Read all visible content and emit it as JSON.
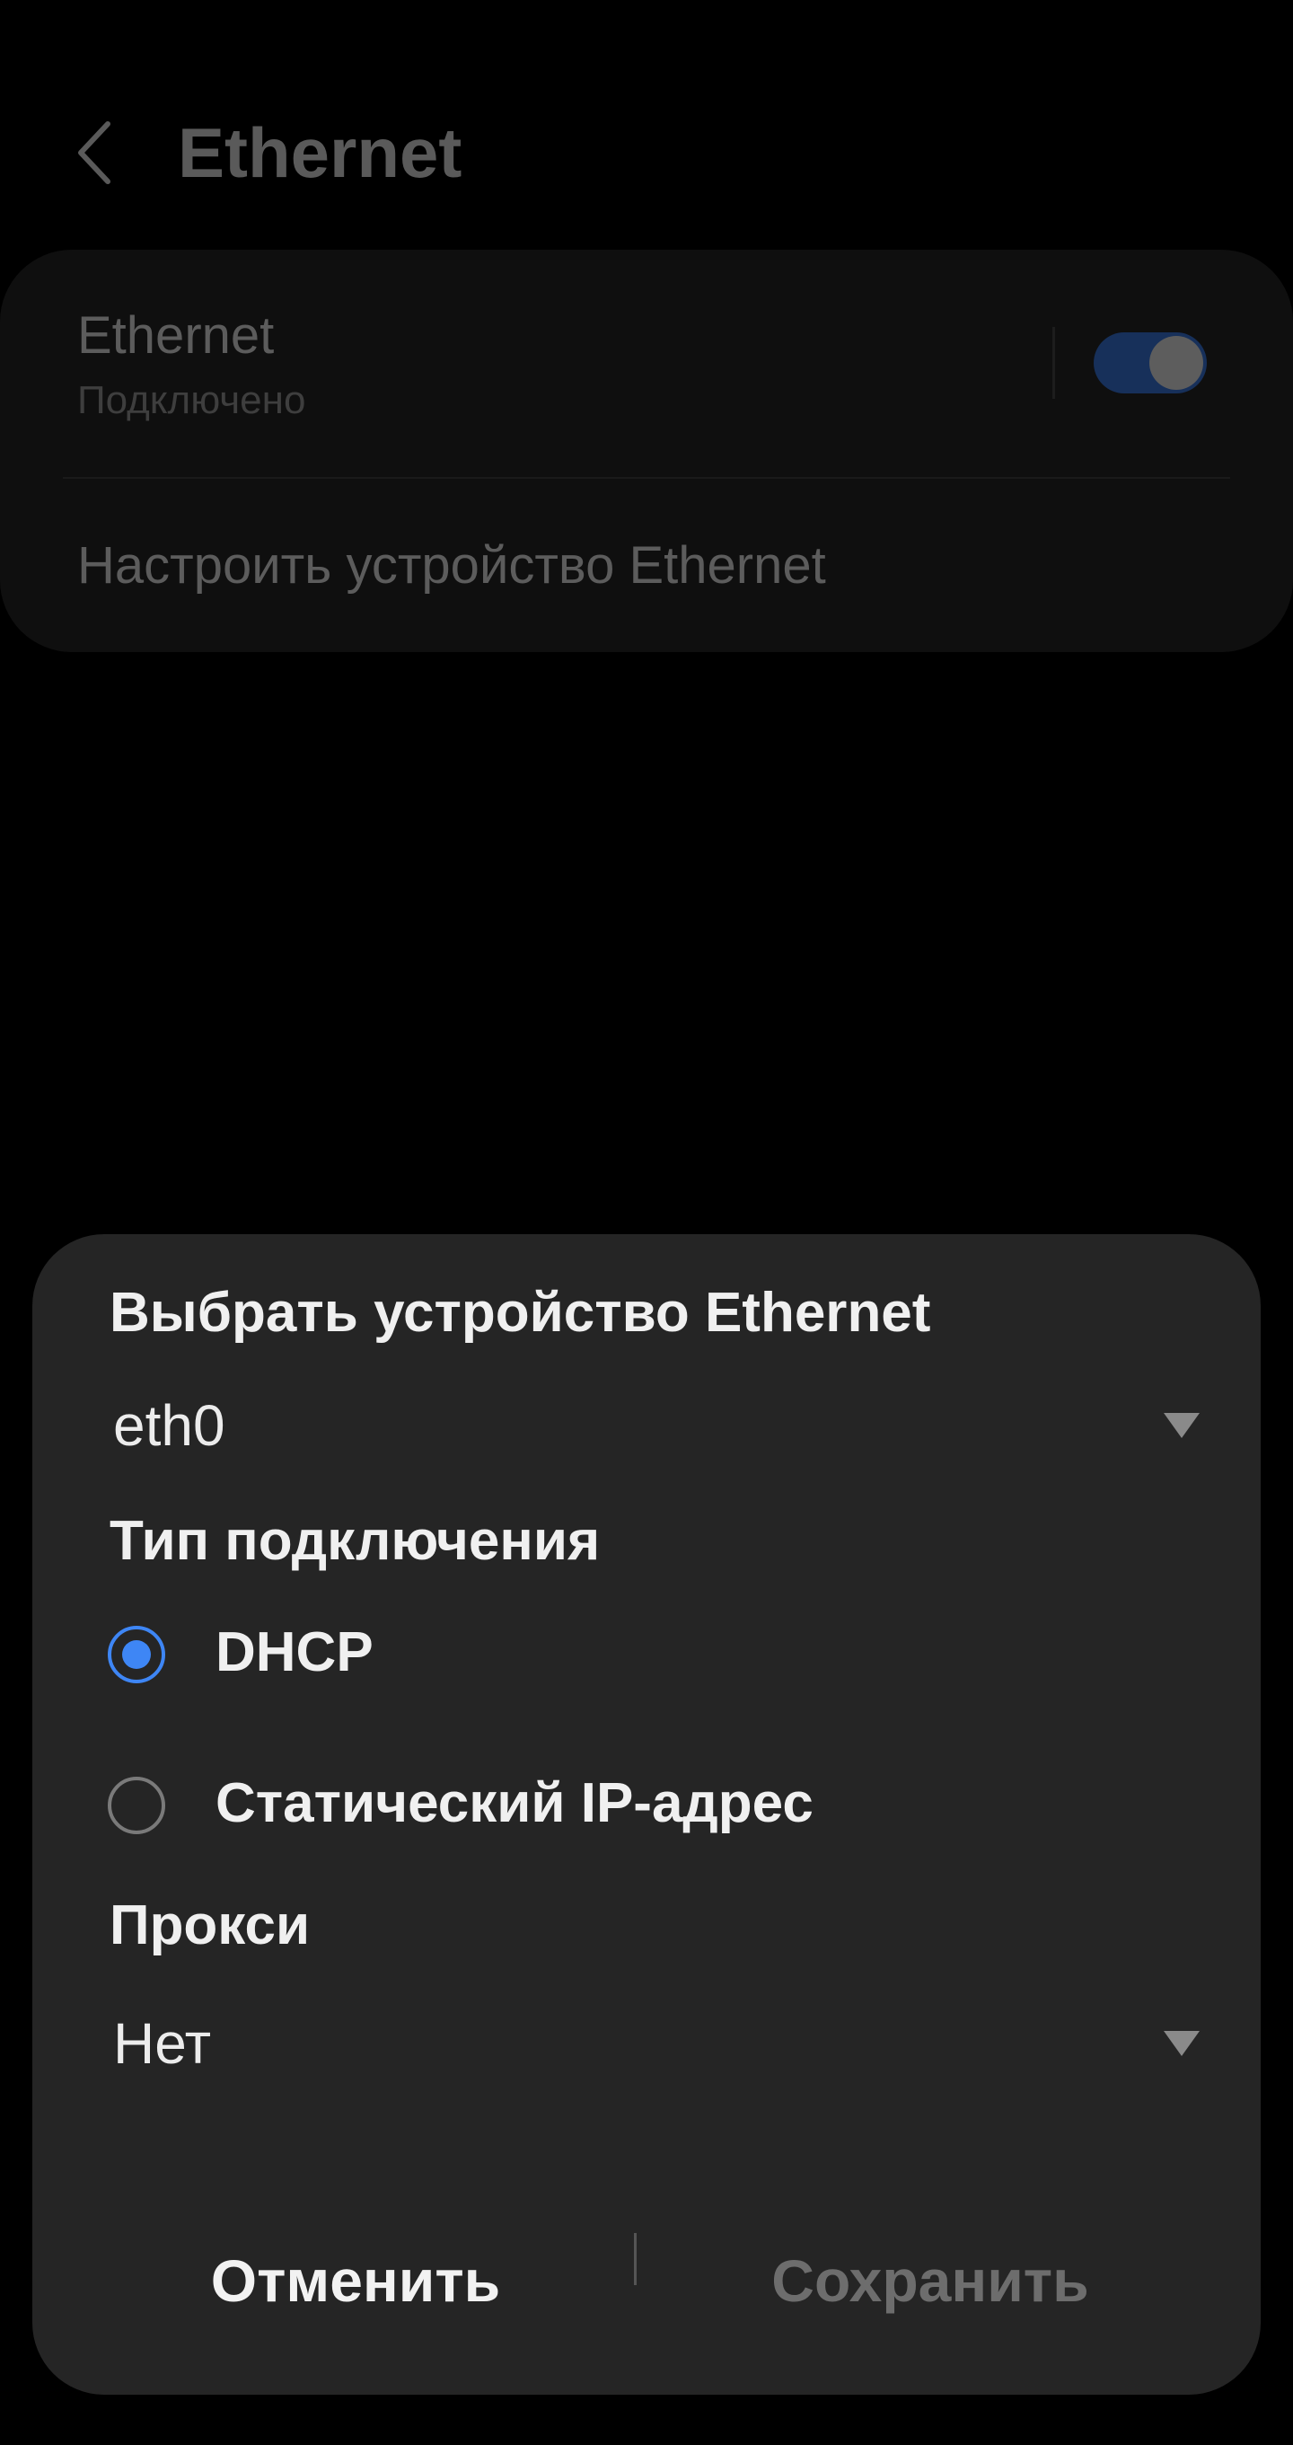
{
  "header": {
    "title": "Ethernet",
    "back_icon": "chevron-left-icon"
  },
  "ethernet_card": {
    "title": "Ethernet",
    "subtitle": "Подключено",
    "toggle_on": true,
    "configure_label": "Настроить устройство Ethernet"
  },
  "dialog": {
    "device_label": "Выбрать устройство Ethernet",
    "device_value": "eth0",
    "connection_type_label": "Тип подключения",
    "options": [
      {
        "label": "DHCP",
        "selected": true
      },
      {
        "label": "Статический IP-адрес",
        "selected": false
      }
    ],
    "proxy_label": "Прокси",
    "proxy_value": "Нет",
    "cancel_label": "Отменить",
    "save_label": "Сохранить"
  },
  "colors": {
    "accent": "#3e86f5",
    "dialog_bg": "#252525",
    "page_bg": "#000000"
  }
}
